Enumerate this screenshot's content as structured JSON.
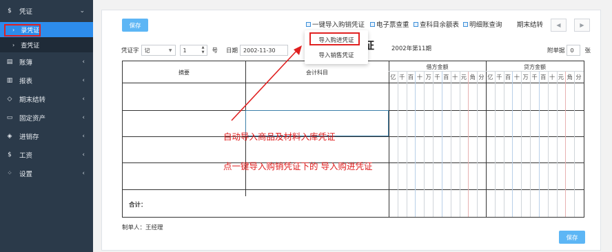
{
  "sidebar": {
    "items": [
      {
        "icon": "$",
        "label": "凭证",
        "chev": "⌄"
      },
      {
        "icon": "▤",
        "label": "账簿",
        "chev": "‹"
      },
      {
        "icon": "▥",
        "label": "报表",
        "chev": "‹"
      },
      {
        "icon": "◇",
        "label": "期末结转",
        "chev": "‹"
      },
      {
        "icon": "▭",
        "label": "固定资产",
        "chev": "‹"
      },
      {
        "icon": "◈",
        "label": "进销存",
        "chev": "‹"
      },
      {
        "icon": "$",
        "label": "工资",
        "chev": "‹"
      },
      {
        "icon": "⁘",
        "label": "设置",
        "chev": "‹"
      }
    ],
    "sub": [
      {
        "label": "录凭证"
      },
      {
        "label": "查凭证"
      }
    ],
    "sub_chev": "›"
  },
  "toolbar": {
    "save": "保存",
    "import_pos": "一键导入购销凭证",
    "einvoice": "电子票查重",
    "balance": "查科目余额表",
    "detail": "明细账查询",
    "period_close": "期末结转",
    "prev": "◀",
    "next": "▶"
  },
  "dropdown": {
    "import_purchase": "导入购进凭证",
    "import_sales": "导入销售凭证"
  },
  "form": {
    "voucher_word_label": "凭证字",
    "voucher_word": "记",
    "number": "1",
    "number_unit": "号",
    "date_label": "日期",
    "date": "2002-11-30",
    "title": "凭证",
    "period": "2002年第11期",
    "attach_label": "附单据",
    "attach_value": "0",
    "attach_unit": "张"
  },
  "table": {
    "col_summary": "摘要",
    "col_account": "会计科目",
    "col_debit": "借方金额",
    "col_credit": "贷方金额",
    "digits": [
      "亿",
      "千",
      "百",
      "十",
      "万",
      "千",
      "百",
      "十",
      "元",
      "角",
      "分"
    ],
    "total_label": "合计："
  },
  "annotations": {
    "line1": "自动导入商品及材料入库凭证",
    "line2": "点一键导入购销凭证下的 导入购进凭证"
  },
  "footer": {
    "maker_label": "制单人：",
    "maker": "王经理",
    "save": "保存"
  },
  "colors": {
    "sidebar_bg": "#2b3a4a",
    "active_blue": "#2d8ceb",
    "button_blue": "#5db6f5",
    "highlight_red": "#e02020"
  }
}
